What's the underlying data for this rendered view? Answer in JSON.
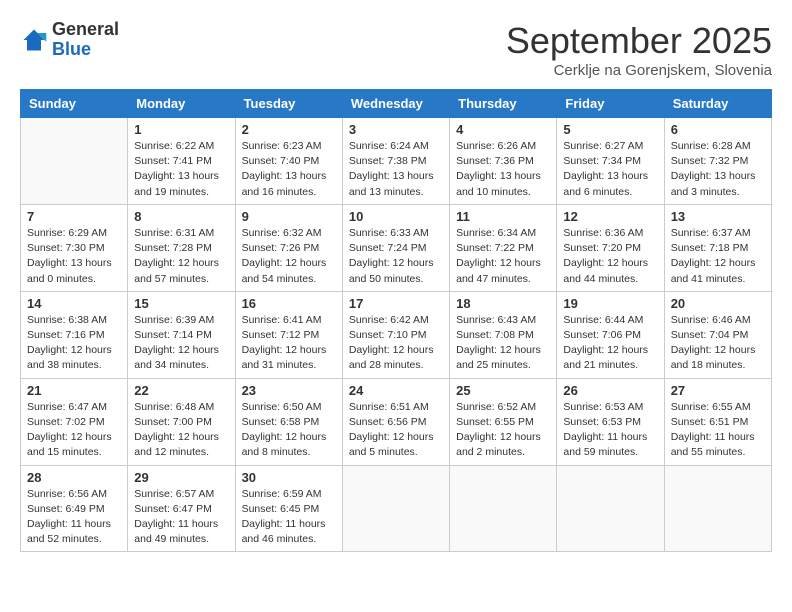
{
  "logo": {
    "general": "General",
    "blue": "Blue"
  },
  "title": "September 2025",
  "location": "Cerklje na Gorenjskem, Slovenia",
  "days_of_week": [
    "Sunday",
    "Monday",
    "Tuesday",
    "Wednesday",
    "Thursday",
    "Friday",
    "Saturday"
  ],
  "weeks": [
    [
      {
        "num": "",
        "info": ""
      },
      {
        "num": "1",
        "info": "Sunrise: 6:22 AM\nSunset: 7:41 PM\nDaylight: 13 hours\nand 19 minutes."
      },
      {
        "num": "2",
        "info": "Sunrise: 6:23 AM\nSunset: 7:40 PM\nDaylight: 13 hours\nand 16 minutes."
      },
      {
        "num": "3",
        "info": "Sunrise: 6:24 AM\nSunset: 7:38 PM\nDaylight: 13 hours\nand 13 minutes."
      },
      {
        "num": "4",
        "info": "Sunrise: 6:26 AM\nSunset: 7:36 PM\nDaylight: 13 hours\nand 10 minutes."
      },
      {
        "num": "5",
        "info": "Sunrise: 6:27 AM\nSunset: 7:34 PM\nDaylight: 13 hours\nand 6 minutes."
      },
      {
        "num": "6",
        "info": "Sunrise: 6:28 AM\nSunset: 7:32 PM\nDaylight: 13 hours\nand 3 minutes."
      }
    ],
    [
      {
        "num": "7",
        "info": "Sunrise: 6:29 AM\nSunset: 7:30 PM\nDaylight: 13 hours\nand 0 minutes."
      },
      {
        "num": "8",
        "info": "Sunrise: 6:31 AM\nSunset: 7:28 PM\nDaylight: 12 hours\nand 57 minutes."
      },
      {
        "num": "9",
        "info": "Sunrise: 6:32 AM\nSunset: 7:26 PM\nDaylight: 12 hours\nand 54 minutes."
      },
      {
        "num": "10",
        "info": "Sunrise: 6:33 AM\nSunset: 7:24 PM\nDaylight: 12 hours\nand 50 minutes."
      },
      {
        "num": "11",
        "info": "Sunrise: 6:34 AM\nSunset: 7:22 PM\nDaylight: 12 hours\nand 47 minutes."
      },
      {
        "num": "12",
        "info": "Sunrise: 6:36 AM\nSunset: 7:20 PM\nDaylight: 12 hours\nand 44 minutes."
      },
      {
        "num": "13",
        "info": "Sunrise: 6:37 AM\nSunset: 7:18 PM\nDaylight: 12 hours\nand 41 minutes."
      }
    ],
    [
      {
        "num": "14",
        "info": "Sunrise: 6:38 AM\nSunset: 7:16 PM\nDaylight: 12 hours\nand 38 minutes."
      },
      {
        "num": "15",
        "info": "Sunrise: 6:39 AM\nSunset: 7:14 PM\nDaylight: 12 hours\nand 34 minutes."
      },
      {
        "num": "16",
        "info": "Sunrise: 6:41 AM\nSunset: 7:12 PM\nDaylight: 12 hours\nand 31 minutes."
      },
      {
        "num": "17",
        "info": "Sunrise: 6:42 AM\nSunset: 7:10 PM\nDaylight: 12 hours\nand 28 minutes."
      },
      {
        "num": "18",
        "info": "Sunrise: 6:43 AM\nSunset: 7:08 PM\nDaylight: 12 hours\nand 25 minutes."
      },
      {
        "num": "19",
        "info": "Sunrise: 6:44 AM\nSunset: 7:06 PM\nDaylight: 12 hours\nand 21 minutes."
      },
      {
        "num": "20",
        "info": "Sunrise: 6:46 AM\nSunset: 7:04 PM\nDaylight: 12 hours\nand 18 minutes."
      }
    ],
    [
      {
        "num": "21",
        "info": "Sunrise: 6:47 AM\nSunset: 7:02 PM\nDaylight: 12 hours\nand 15 minutes."
      },
      {
        "num": "22",
        "info": "Sunrise: 6:48 AM\nSunset: 7:00 PM\nDaylight: 12 hours\nand 12 minutes."
      },
      {
        "num": "23",
        "info": "Sunrise: 6:50 AM\nSunset: 6:58 PM\nDaylight: 12 hours\nand 8 minutes."
      },
      {
        "num": "24",
        "info": "Sunrise: 6:51 AM\nSunset: 6:56 PM\nDaylight: 12 hours\nand 5 minutes."
      },
      {
        "num": "25",
        "info": "Sunrise: 6:52 AM\nSunset: 6:55 PM\nDaylight: 12 hours\nand 2 minutes."
      },
      {
        "num": "26",
        "info": "Sunrise: 6:53 AM\nSunset: 6:53 PM\nDaylight: 11 hours\nand 59 minutes."
      },
      {
        "num": "27",
        "info": "Sunrise: 6:55 AM\nSunset: 6:51 PM\nDaylight: 11 hours\nand 55 minutes."
      }
    ],
    [
      {
        "num": "28",
        "info": "Sunrise: 6:56 AM\nSunset: 6:49 PM\nDaylight: 11 hours\nand 52 minutes."
      },
      {
        "num": "29",
        "info": "Sunrise: 6:57 AM\nSunset: 6:47 PM\nDaylight: 11 hours\nand 49 minutes."
      },
      {
        "num": "30",
        "info": "Sunrise: 6:59 AM\nSunset: 6:45 PM\nDaylight: 11 hours\nand 46 minutes."
      },
      {
        "num": "",
        "info": ""
      },
      {
        "num": "",
        "info": ""
      },
      {
        "num": "",
        "info": ""
      },
      {
        "num": "",
        "info": ""
      }
    ]
  ]
}
